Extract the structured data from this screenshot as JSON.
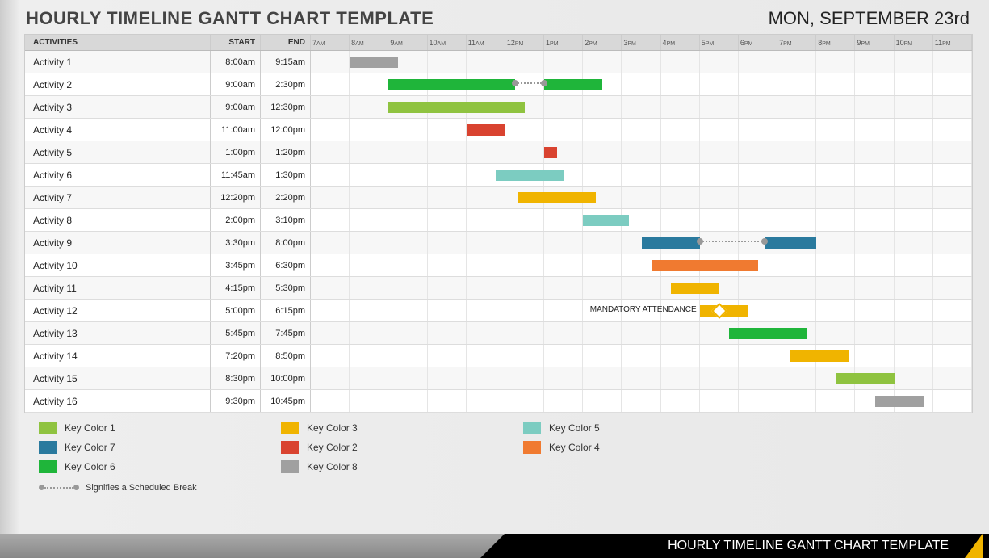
{
  "title": "HOURLY TIMELINE GANTT CHART TEMPLATE",
  "date": "MON, SEPTEMBER 23rd",
  "footer_title": "HOURLY TIMELINE GANTT CHART TEMPLATE",
  "columns": {
    "act": "ACTIVITIES",
    "start": "START",
    "end": "END"
  },
  "hours": [
    "7AM",
    "8AM",
    "9AM",
    "10AM",
    "11AM",
    "12PM",
    "1PM",
    "2PM",
    "3PM",
    "4PM",
    "5PM",
    "6PM",
    "7PM",
    "8PM",
    "9PM",
    "10PM",
    "11PM"
  ],
  "colors": {
    "c1": "#8fc340",
    "c2": "#d94330",
    "c3": "#f0b400",
    "c4": "#f07a30",
    "c5": "#7cccc1",
    "c6": "#1fb53a",
    "c7": "#2a7a9e",
    "c8": "#a0a0a0"
  },
  "legend": [
    {
      "label": "Key Color 1",
      "c": "c1"
    },
    {
      "label": "Key Color 3",
      "c": "c3"
    },
    {
      "label": "Key Color 5",
      "c": "c5"
    },
    {
      "label": "Key Color 7",
      "c": "c7"
    },
    {
      "label": "Key Color 2",
      "c": "c2"
    },
    {
      "label": "Key Color 4",
      "c": "c4"
    },
    {
      "label": "Key Color 6",
      "c": "c6"
    },
    {
      "label": "Key Color 8",
      "c": "c8"
    }
  ],
  "break_label": "Signifies a Scheduled Break",
  "annotation": "MANDATORY ATTENDANCE",
  "chart_data": {
    "type": "gantt",
    "time_start_hour": 7,
    "time_end_hour": 24,
    "activities": [
      {
        "name": "Activity 1",
        "start": "8:00am",
        "end": "9:15am",
        "bars": [
          {
            "from": 8,
            "to": 9.25,
            "color": "c8"
          }
        ]
      },
      {
        "name": "Activity 2",
        "start": "9:00am",
        "end": "2:30pm",
        "bars": [
          {
            "from": 9,
            "to": 12.25,
            "color": "c6"
          },
          {
            "from": 13,
            "to": 14.5,
            "color": "c6"
          }
        ],
        "break": {
          "from": 12.25,
          "to": 13
        }
      },
      {
        "name": "Activity 3",
        "start": "9:00am",
        "end": "12:30pm",
        "bars": [
          {
            "from": 9,
            "to": 12.5,
            "color": "c1"
          }
        ]
      },
      {
        "name": "Activity 4",
        "start": "11:00am",
        "end": "12:00pm",
        "bars": [
          {
            "from": 11,
            "to": 12,
            "color": "c2"
          }
        ]
      },
      {
        "name": "Activity 5",
        "start": "1:00pm",
        "end": "1:20pm",
        "bars": [
          {
            "from": 13,
            "to": 13.33,
            "color": "c2"
          }
        ]
      },
      {
        "name": "Activity 6",
        "start": "11:45am",
        "end": "1:30pm",
        "bars": [
          {
            "from": 11.75,
            "to": 13.5,
            "color": "c5"
          }
        ]
      },
      {
        "name": "Activity 7",
        "start": "12:20pm",
        "end": "2:20pm",
        "bars": [
          {
            "from": 12.33,
            "to": 14.33,
            "color": "c3"
          }
        ]
      },
      {
        "name": "Activity 8",
        "start": "2:00pm",
        "end": "3:10pm",
        "bars": [
          {
            "from": 14,
            "to": 15.17,
            "color": "c5"
          }
        ]
      },
      {
        "name": "Activity 9",
        "start": "3:30pm",
        "end": "8:00pm",
        "bars": [
          {
            "from": 15.5,
            "to": 17,
            "color": "c7"
          },
          {
            "from": 18.67,
            "to": 20,
            "color": "c7"
          }
        ],
        "break": {
          "from": 17,
          "to": 18.67
        }
      },
      {
        "name": "Activity 10",
        "start": "3:45pm",
        "end": "6:30pm",
        "bars": [
          {
            "from": 15.75,
            "to": 18.5,
            "color": "c4"
          }
        ]
      },
      {
        "name": "Activity 11",
        "start": "4:15pm",
        "end": "5:30pm",
        "bars": [
          {
            "from": 16.25,
            "to": 17.5,
            "color": "c3"
          }
        ]
      },
      {
        "name": "Activity 12",
        "start": "5:00pm",
        "end": "6:15pm",
        "bars": [
          {
            "from": 17,
            "to": 18.25,
            "color": "c3"
          }
        ],
        "milestone": 17.5,
        "annotation": "MANDATORY ATTENDANCE"
      },
      {
        "name": "Activity 13",
        "start": "5:45pm",
        "end": "7:45pm",
        "bars": [
          {
            "from": 17.75,
            "to": 19.75,
            "color": "c6"
          }
        ]
      },
      {
        "name": "Activity 14",
        "start": "7:20pm",
        "end": "8:50pm",
        "bars": [
          {
            "from": 19.33,
            "to": 20.83,
            "color": "c3"
          }
        ]
      },
      {
        "name": "Activity 15",
        "start": "8:30pm",
        "end": "10:00pm",
        "bars": [
          {
            "from": 20.5,
            "to": 22,
            "color": "c1"
          }
        ]
      },
      {
        "name": "Activity 16",
        "start": "9:30pm",
        "end": "10:45pm",
        "bars": [
          {
            "from": 21.5,
            "to": 22.75,
            "color": "c8"
          }
        ]
      }
    ]
  }
}
